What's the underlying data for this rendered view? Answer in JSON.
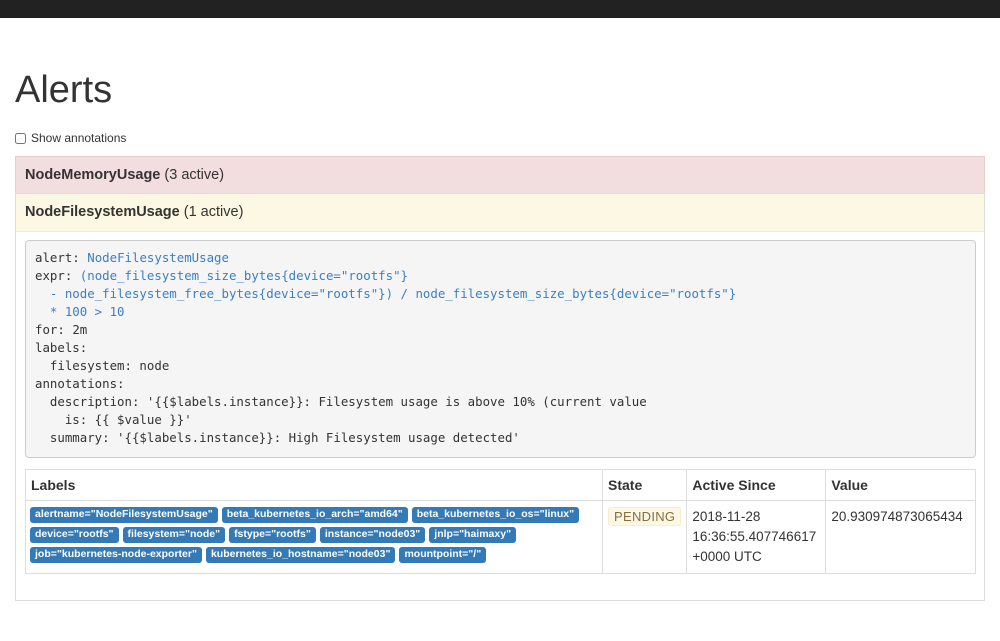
{
  "page": {
    "title": "Alerts"
  },
  "options": {
    "show_annotations_label": "Show annotations",
    "show_annotations_checked": false
  },
  "groups": [
    {
      "name": "NodeMemoryUsage",
      "count_text": "(3 active)",
      "status_color": "#f2dede"
    },
    {
      "name": "NodeFilesystemUsage",
      "count_text": "(1 active)",
      "status_color": "#fcf8e3"
    }
  ],
  "rule": {
    "k_alert": "alert:",
    "alert": "NodeFilesystemUsage",
    "k_expr": "expr:",
    "expr_line1": "(node_filesystem_size_bytes{device=\"rootfs\"}",
    "expr_line2": "  - node_filesystem_free_bytes{device=\"rootfs\"}) / node_filesystem_size_bytes{device=\"rootfs\"}",
    "expr_line3": "  * 100 > 10",
    "k_for": "for:",
    "for": "2m",
    "k_labels": "labels:",
    "labels_line": "  filesystem: node",
    "k_annotations": "annotations:",
    "desc_line1": "  description: '{{$labels.instance}}: Filesystem usage is above 10% (current value",
    "desc_line2": "    is: {{ $value }}'",
    "summary_line": "  summary: '{{$labels.instance}}: High Filesystem usage detected'"
  },
  "table": {
    "headers": {
      "labels": "Labels",
      "state": "State",
      "active_since": "Active Since",
      "value": "Value"
    },
    "rows": [
      {
        "labels": [
          "alertname=\"NodeFilesystemUsage\"",
          "beta_kubernetes_io_arch=\"amd64\"",
          "beta_kubernetes_io_os=\"linux\"",
          "device=\"rootfs\"",
          "filesystem=\"node\"",
          "fstype=\"rootfs\"",
          "instance=\"node03\"",
          "jnlp=\"haimaxy\"",
          "job=\"kubernetes-node-exporter\"",
          "kubernetes_io_hostname=\"node03\"",
          "mountpoint=\"/\""
        ],
        "state": "PENDING",
        "active_since": "2018-11-28 16:36:55.407746617 +0000 UTC",
        "value": "20.930974873065434"
      }
    ]
  },
  "colors": {
    "label_badge": "#337ab7",
    "firing": "#f2dede",
    "pending": "#fcf8e3"
  }
}
